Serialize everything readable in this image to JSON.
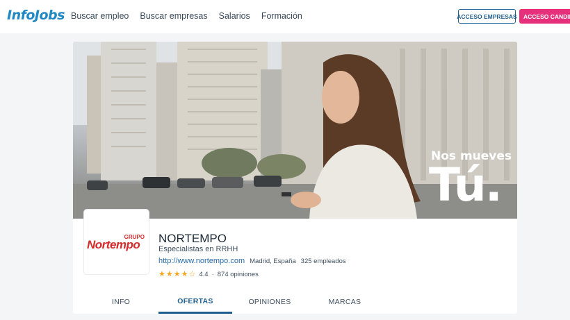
{
  "header": {
    "logo": "InfoJobs",
    "nav": [
      "Buscar empleo",
      "Buscar empresas",
      "Salarios",
      "Formación"
    ],
    "btn_empresas": "ACCESO EMPRESAS",
    "btn_candidatos": "ACCESO CANDIDATOS"
  },
  "banner": {
    "slogan_line1": "Nos mueves",
    "slogan_line2": "Tú."
  },
  "company": {
    "logo_grupo": "GRUPO",
    "logo_word": "Nortempo",
    "name": "NORTEMPO",
    "tagline": "Especialistas en RRHH",
    "url": "http://www.nortempo.com",
    "location": "Madrid, España",
    "employees": "325 empleados",
    "rating": "4.4",
    "rating_sep": "·",
    "opinions": "874 opiniones"
  },
  "tabs": [
    "INFO",
    "OFERTAS",
    "OPINIONES",
    "MARCAS"
  ],
  "colors": {
    "brand_blue": "#2088c2",
    "accent_pink": "#e6307b",
    "tab_active": "#1f5f8f",
    "star": "#f5a623"
  }
}
